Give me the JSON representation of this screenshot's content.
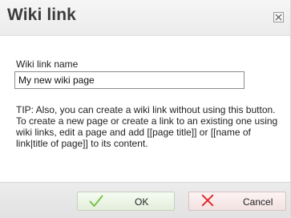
{
  "dialog": {
    "title": "Wiki link",
    "close_icon": "close-icon"
  },
  "form": {
    "name_label": "Wiki link name",
    "name_value": "My new wiki page",
    "tip": "TIP: Also, you can create a wiki link without using this button. To create a new page or create a link to an existing one using wiki links, edit a page and add [[page title]] or [[name of link|title of page]] to its content."
  },
  "buttons": {
    "ok_label": "OK",
    "ok_icon": "checkmark-icon",
    "cancel_label": "Cancel",
    "cancel_icon": "x-icon"
  },
  "colors": {
    "ok_check": "#6cbf3a",
    "cancel_x": "#e0262b"
  }
}
